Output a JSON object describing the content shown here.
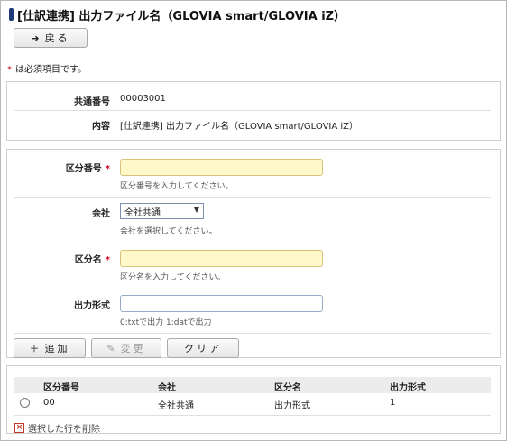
{
  "page": {
    "title": "[仕訳連携] 出力ファイル名（GLOVIA smart/GLOVIA iZ）",
    "back_label": "戻る",
    "required_note": "は必須項目です。",
    "required_star": "*"
  },
  "info": {
    "common_no_label": "共通番号",
    "common_no_value": "00003001",
    "content_label": "内容",
    "content_value": "[仕訳連携] 出力ファイル名（GLOVIA smart/GLOVIA iZ）"
  },
  "form": {
    "category_no_label": "区分番号",
    "category_no_value": "",
    "category_no_hint": "区分番号を入力してください。",
    "company_label": "会社",
    "company_value": "全社共通",
    "company_hint": "会社を選択してください。",
    "category_name_label": "区分名",
    "category_name_value": "",
    "category_name_hint": "区分名を入力してください。",
    "output_format_label": "出力形式",
    "output_format_value": "",
    "output_format_hint": "0:txtで出力 1:datで出力",
    "add_label": "追加",
    "change_label": "変更",
    "clear_label": "クリア"
  },
  "table": {
    "headers": [
      "区分番号",
      "会社",
      "区分名",
      "出力形式"
    ],
    "rows": [
      [
        "00",
        "全社共通",
        "出力形式",
        "1"
      ]
    ],
    "delete_label": "選択した行を削除"
  },
  "colors": {
    "title_mark": "#203a78",
    "required_star": "#d0021b",
    "required_input_bg": "#fff8c8"
  }
}
